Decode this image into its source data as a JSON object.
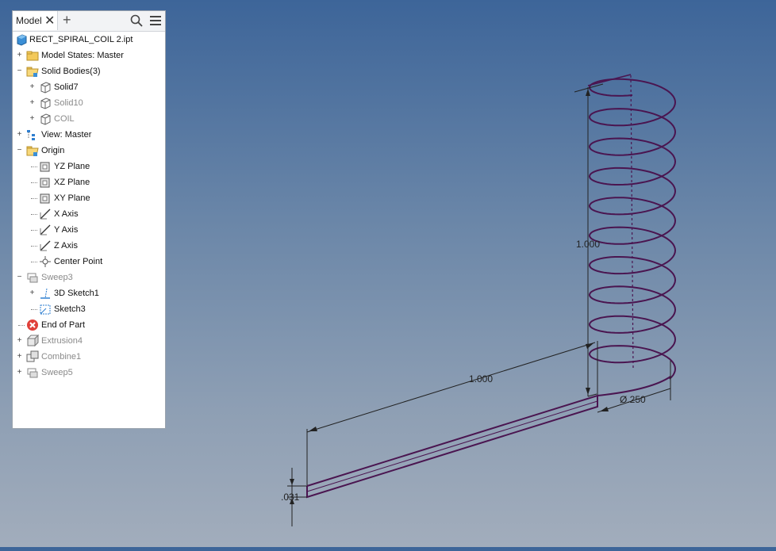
{
  "panel": {
    "tab_label": "Model",
    "close_glyph": "✕",
    "add_glyph": "+",
    "icons": [
      "search-icon",
      "hamburger-menu-icon"
    ]
  },
  "tree": {
    "root": "RECT_SPIRAL_COIL 2.ipt",
    "items": [
      {
        "label": "Model States: Master",
        "expander": "+",
        "icon": "folder-icon",
        "dim": false
      },
      {
        "label": "Solid Bodies(3)",
        "expander": "−",
        "icon": "folder-open-icon",
        "dim": false
      },
      {
        "label": "Solid7",
        "expander": "+",
        "icon": "solid-body-icon",
        "dim": false
      },
      {
        "label": "Solid10",
        "expander": "+",
        "icon": "solid-body-icon",
        "dim": true
      },
      {
        "label": "COIL",
        "expander": "+",
        "icon": "solid-body-icon",
        "dim": true
      },
      {
        "label": "View: Master",
        "expander": "+",
        "icon": "view-icon",
        "dim": false
      },
      {
        "label": "Origin",
        "expander": "−",
        "icon": "folder-open-icon",
        "dim": false
      },
      {
        "label": "YZ Plane",
        "expander": "",
        "icon": "plane-icon",
        "dim": false
      },
      {
        "label": "XZ Plane",
        "expander": "",
        "icon": "plane-icon",
        "dim": false
      },
      {
        "label": "XY Plane",
        "expander": "",
        "icon": "plane-icon",
        "dim": false
      },
      {
        "label": "X Axis",
        "expander": "",
        "icon": "axis-icon",
        "dim": false
      },
      {
        "label": "Y Axis",
        "expander": "",
        "icon": "axis-icon",
        "dim": false
      },
      {
        "label": "Z Axis",
        "expander": "",
        "icon": "axis-icon",
        "dim": false
      },
      {
        "label": "Center Point",
        "expander": "",
        "icon": "point-icon",
        "dim": false
      },
      {
        "label": "Sweep3",
        "expander": "−",
        "icon": "sweep-icon",
        "dim": true
      },
      {
        "label": "3D Sketch1",
        "expander": "+",
        "icon": "sketch3d-icon",
        "dim": false
      },
      {
        "label": "Sketch3",
        "expander": "",
        "icon": "sketch-icon",
        "dim": false
      },
      {
        "label": "End of Part",
        "expander": "",
        "icon": "end-of-part-icon",
        "dim": false
      },
      {
        "label": "Extrusion4",
        "expander": "+",
        "icon": "extrusion-icon",
        "dim": true
      },
      {
        "label": "Combine1",
        "expander": "+",
        "icon": "combine-icon",
        "dim": true
      },
      {
        "label": "Sweep5",
        "expander": "+",
        "icon": "sweep-icon",
        "dim": true
      }
    ]
  },
  "viewport": {
    "dim_height": "1.000",
    "dim_length": "1.000",
    "dim_diameter": "Ø.250",
    "dim_thickness": ".031",
    "curve_color": "#4a1550"
  }
}
